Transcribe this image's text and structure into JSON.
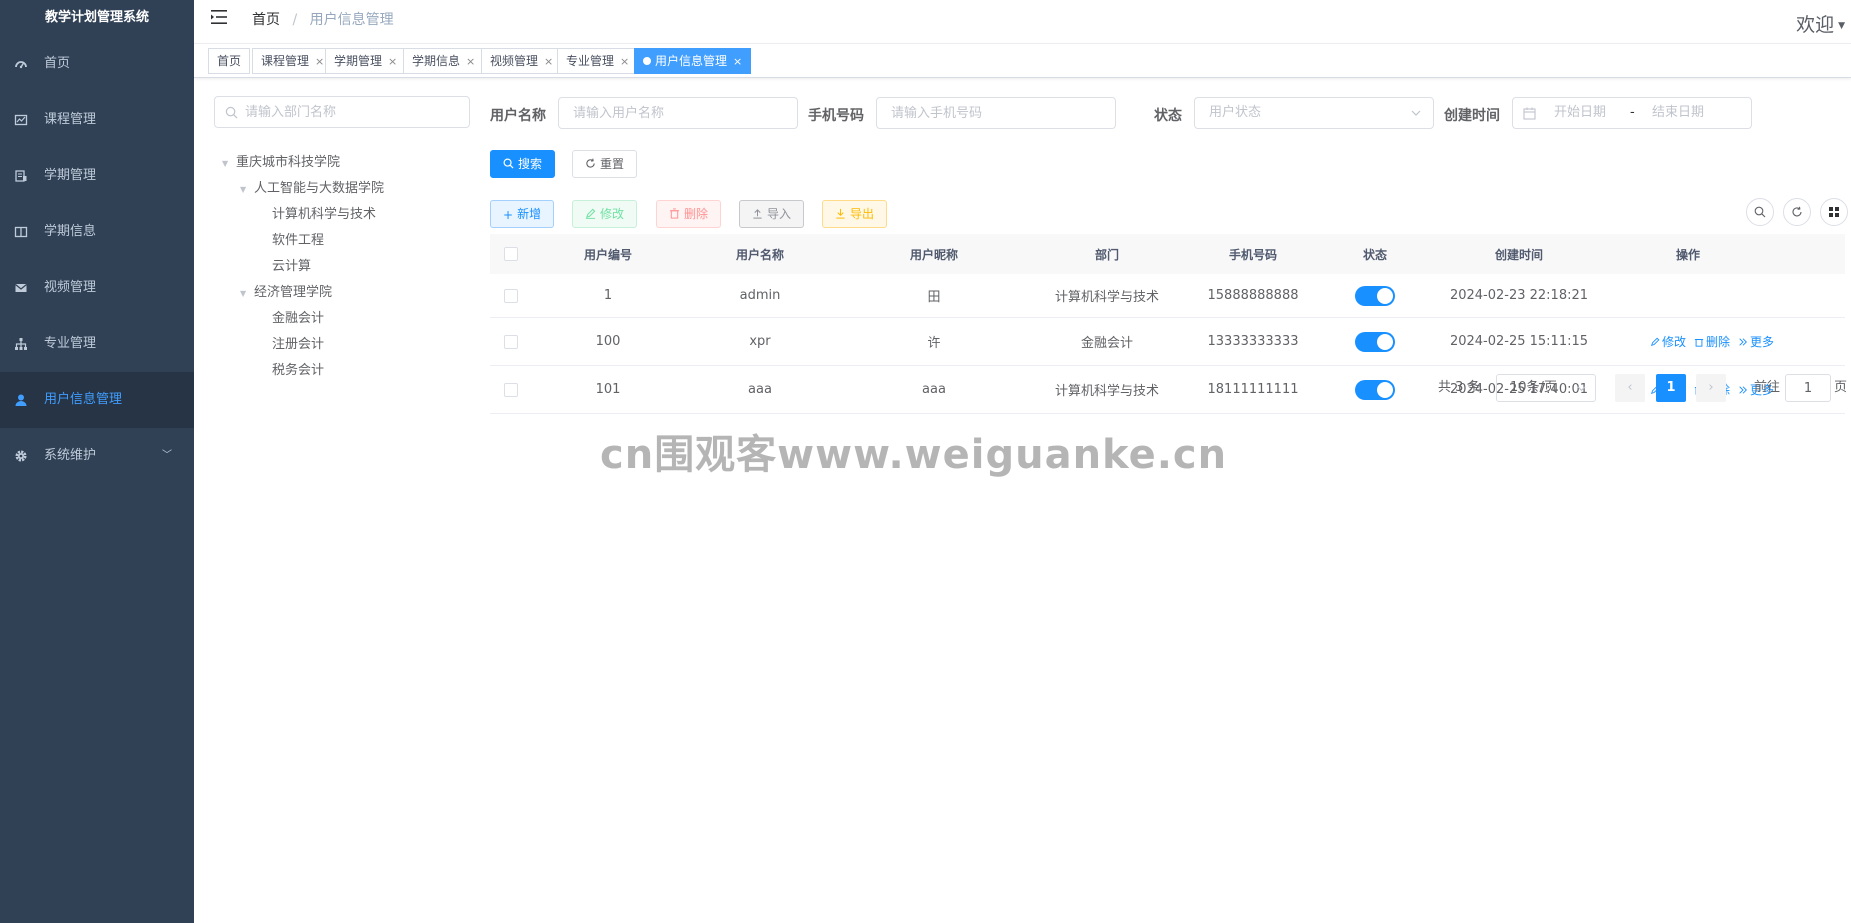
{
  "app": {
    "title": "教学计划管理系统"
  },
  "sidebar": {
    "items": [
      {
        "label": "首页",
        "icon": "dashboard-icon"
      },
      {
        "label": "课程管理",
        "icon": "chart-icon"
      },
      {
        "label": "学期管理",
        "icon": "document-icon"
      },
      {
        "label": "学期信息",
        "icon": "book-icon"
      },
      {
        "label": "视频管理",
        "icon": "mail-icon"
      },
      {
        "label": "专业管理",
        "icon": "tree-icon"
      },
      {
        "label": "用户信息管理",
        "icon": "user-icon"
      },
      {
        "label": "系统维护",
        "icon": "gear-icon"
      }
    ],
    "active_index": 6
  },
  "navbar": {
    "breadcrumb_home": "首页",
    "breadcrumb_separator": "/",
    "breadcrumb_current": "用户信息管理",
    "welcome": "欢迎"
  },
  "tags": [
    {
      "label": "首页",
      "closable": false
    },
    {
      "label": "课程管理",
      "closable": true
    },
    {
      "label": "学期管理",
      "closable": true
    },
    {
      "label": "学期信息",
      "closable": true
    },
    {
      "label": "视频管理",
      "closable": true
    },
    {
      "label": "专业管理",
      "closable": true
    },
    {
      "label": "用户信息管理",
      "closable": true,
      "active": true
    }
  ],
  "tag_close_symbol": "×",
  "dept": {
    "search_placeholder": "请输入部门名称",
    "tree": [
      {
        "label": "重庆城市科技学院",
        "level": 1,
        "expanded": true
      },
      {
        "label": "人工智能与大数据学院",
        "level": 2,
        "expanded": true
      },
      {
        "label": "计算机科学与技术",
        "level": 3
      },
      {
        "label": "软件工程",
        "level": 3
      },
      {
        "label": "云计算",
        "level": 3
      },
      {
        "label": "经济管理学院",
        "level": 2,
        "expanded": true
      },
      {
        "label": "金融会计",
        "level": 3
      },
      {
        "label": "注册会计",
        "level": 3
      },
      {
        "label": "税务会计",
        "level": 3
      }
    ]
  },
  "query": {
    "username_label": "用户名称",
    "username_placeholder": "请输入用户名称",
    "phone_label": "手机号码",
    "phone_placeholder": "请输入手机号码",
    "status_label": "状态",
    "status_placeholder": "用户状态",
    "created_label": "创建时间",
    "start_placeholder": "开始日期",
    "range_separator": "-",
    "end_placeholder": "结束日期",
    "search_button": "搜索",
    "reset_button": "重置"
  },
  "toolbar": {
    "add": "新增",
    "edit": "修改",
    "delete": "删除",
    "import": "导入",
    "export": "导出"
  },
  "table": {
    "columns": [
      "用户编号",
      "用户名称",
      "用户昵称",
      "部门",
      "手机号码",
      "状态",
      "创建时间",
      "操作"
    ],
    "rows": [
      {
        "id": "1",
        "username": "admin",
        "nickname": "田",
        "dept": "计算机科学与技术",
        "phone": "15888888888",
        "status_on": true,
        "created": "2024-02-23 22:18:21",
        "has_ops": false
      },
      {
        "id": "100",
        "username": "xpr",
        "nickname": "许",
        "dept": "金融会计",
        "phone": "13333333333",
        "status_on": true,
        "created": "2024-02-25 15:11:15",
        "has_ops": true
      },
      {
        "id": "101",
        "username": "aaa",
        "nickname": "aaa",
        "dept": "计算机科学与技术",
        "phone": "18111111111",
        "status_on": true,
        "created": "2024-02-25 17:40:01",
        "has_ops": true
      }
    ],
    "op_edit": "修改",
    "op_delete": "删除",
    "op_more": "更多"
  },
  "pagination": {
    "total_text": "共 3 条",
    "page_size": "10条/页",
    "current_page": "1",
    "goto_label": "前往",
    "goto_value": "1",
    "page_suffix": "页"
  },
  "watermark": "cn围观客www.weiguanke.cn",
  "colors": {
    "sidebar_bg": "#304156",
    "sidebar_text": "#bfcbd9",
    "primary": "#1890ff",
    "active_menu": "#409eff"
  }
}
